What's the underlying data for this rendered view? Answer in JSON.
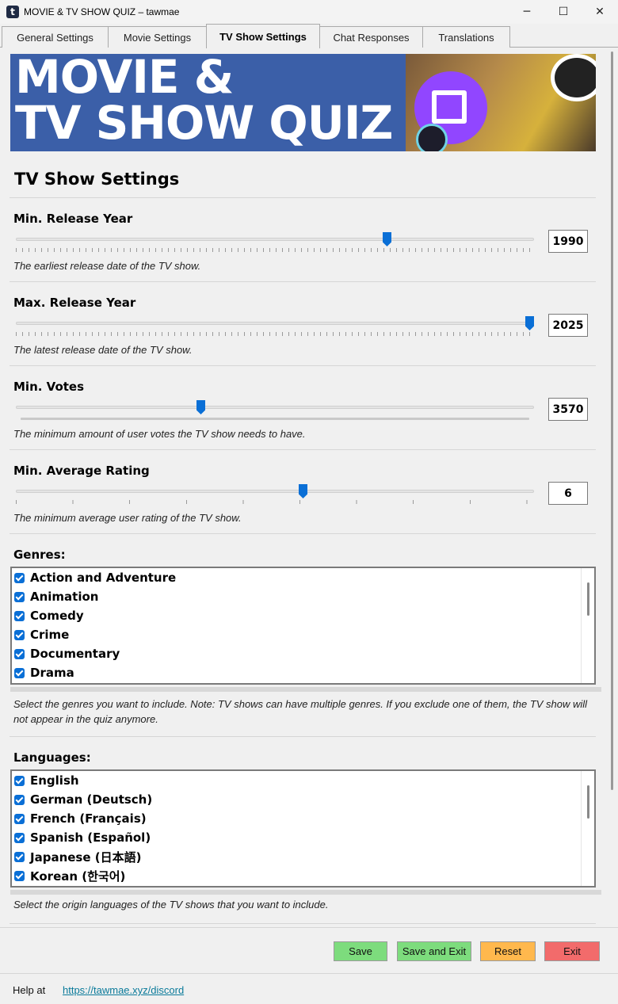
{
  "window": {
    "title": "MOVIE & TV SHOW QUIZ – tawmae",
    "controls": {
      "minimize": "─",
      "maximize": "☐",
      "close": "✕"
    }
  },
  "tabs": [
    {
      "label": "General Settings",
      "active": false
    },
    {
      "label": "Movie Settings",
      "active": false
    },
    {
      "label": "TV Show Settings",
      "active": true
    },
    {
      "label": "Chat Responses",
      "active": false
    },
    {
      "label": "Translations",
      "active": false
    }
  ],
  "banner": {
    "line1": "MOVIE &",
    "line2": "TV SHOW QUIZ"
  },
  "page_title": "TV Show Settings",
  "settings": {
    "min_year": {
      "label": "Min. Release Year",
      "value": "1990",
      "level": 0.72,
      "desc": "The earliest release date of the TV show."
    },
    "max_year": {
      "label": "Max. Release Year",
      "value": "2025",
      "level": 1.0,
      "desc": "The latest release date of the TV show."
    },
    "min_votes": {
      "label": "Min. Votes",
      "value": "3570",
      "level": 0.355,
      "desc": "The minimum amount of user votes the TV show needs to have."
    },
    "min_rating": {
      "label": "Min. Average Rating",
      "value": "6",
      "level": 0.555,
      "desc": "The minimum average user rating of the TV show."
    }
  },
  "genres": {
    "label": "Genres:",
    "items": [
      "Action and Adventure",
      "Animation",
      "Comedy",
      "Crime",
      "Documentary",
      "Drama"
    ],
    "desc": "Select the genres you want to include. Note: TV shows can have multiple genres. If you exclude one of them, the TV show will not appear in the quiz anymore."
  },
  "languages": {
    "label": "Languages:",
    "items": [
      "English",
      "German (Deutsch)",
      "French (Français)",
      "Spanish (Español)",
      "Japanese (日本語)",
      "Korean (한국어)"
    ],
    "desc": "Select the origin languages of the TV shows that you want to include."
  },
  "buttons": {
    "save": {
      "label": "Save",
      "color": "#7ddc7d"
    },
    "save_exit": {
      "label": "Save and Exit",
      "color": "#7ddc7d"
    },
    "reset": {
      "label": "Reset",
      "color": "#ffb84d"
    },
    "exit": {
      "label": "Exit",
      "color": "#f26b6b"
    }
  },
  "footer": {
    "help_label": "Help at",
    "help_link": "https://tawmae.xyz/discord"
  }
}
